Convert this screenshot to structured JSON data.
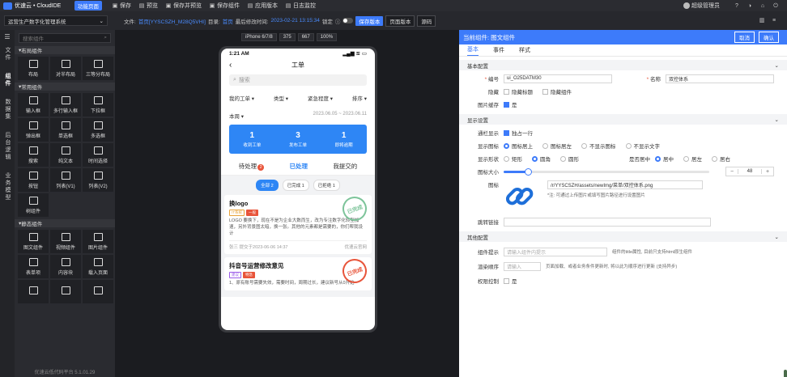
{
  "topbar": {
    "brand": "优速云 • CloudIDE",
    "page_badge": "功能页面",
    "actions": [
      "保存",
      "预览",
      "保存并预览",
      "保存组件",
      "应用版本",
      "日志监控"
    ],
    "user": "超级管理员"
  },
  "secbar": {
    "system": "运营生产数字化管理系统",
    "file_label": "文件:",
    "file_link": "首页[YYSCSZH_M28Q5VHI]",
    "dir_label": "目录:",
    "dir_link": "首页",
    "modified_label": "最后修改时间:",
    "modified_time": "2023-02-21 13:15:34",
    "lock_label": "锁定",
    "btn_save_version": "保存版本",
    "btn_page_version": "页面版本",
    "btn_source": "源码"
  },
  "vtabs": [
    "文件",
    "组件",
    "数据集",
    "后台逻辑",
    "业务模型"
  ],
  "companel": {
    "search_placeholder": "搜索组件",
    "groups": [
      {
        "title": "布局组件",
        "items": [
          "布局",
          "对半布局",
          "三等分布局"
        ]
      },
      {
        "title": "常用组件",
        "items": [
          "输入框",
          "多行输入框",
          "下拉框",
          "弹出框",
          "单选框",
          "多选框",
          "搜索",
          "纯文本",
          "时间选择",
          "按钮",
          "列表(V1)",
          "列表(V2)",
          "树组件"
        ]
      },
      {
        "title": "静态组件",
        "items": [
          "图文组件",
          "视频组件",
          "图片组件",
          "表单项",
          "内容块",
          "载入页面",
          "",
          "",
          ""
        ]
      }
    ],
    "version": "优速云低代码平台 5.1.01.29"
  },
  "devbar": {
    "device": "iPhone 6/7/8",
    "width": "375",
    "height": "667",
    "zoom": "100%"
  },
  "phone": {
    "time": "1:21 AM",
    "signal": "▂▄▆ ≋ ▭",
    "title": "工单",
    "search_placeholder": "搜索",
    "filters": [
      "我的工单 ▾",
      "类型 ▾",
      "紧急程度 ▾",
      "排序 ▾"
    ],
    "period_label": "本周 ▾",
    "period_range": "2023.06.05 ~ 2023.06.11",
    "stats": [
      {
        "n": "1",
        "l": "收到工单"
      },
      {
        "n": "3",
        "l": "发布工单"
      },
      {
        "n": "1",
        "l": "即将逾期"
      }
    ],
    "tabs": [
      "待处理",
      "已处理",
      "我提交的"
    ],
    "tab_count": "2",
    "chips": [
      "全部 2",
      "已完成 1",
      "已拒绝 1"
    ],
    "cards": [
      {
        "title": "换logo",
        "tags": [
          "IT系统",
          "一般"
        ],
        "body": "LOGO 要换下，现在不是为企业大数而生，改为专注数字化转型加速，另外背景图太暗，换一张。其他的元素都是需要的，你们帮我设计",
        "author": "张三 提交于2023-06-06 14:37",
        "org": "优速云官网",
        "stamp": "已完成"
      },
      {
        "title": "抖音号运营修改意见",
        "tags": [
          "建议",
          "特急"
        ],
        "body": "1、原有账号需要失效，需要时间，周期过长，建议新号从0开始",
        "author": "",
        "org": "",
        "stamp": "已完成"
      }
    ]
  },
  "props": {
    "header": "当前组件: 图文组件",
    "cancel": "取消",
    "confirm": "确认",
    "tabs": [
      "基本",
      "事件",
      "样式"
    ],
    "basic": {
      "title": "基本配置",
      "code_label": "编号",
      "code_value": "ui_O25DATM30",
      "name_label": "名称",
      "name_value": "双控体系",
      "hide_label": "隐藏",
      "hide_title": "隐藏标题",
      "hide_comp": "隐藏组件",
      "cache_label": "图片缓存",
      "cache_value": "是"
    },
    "display": {
      "title": "显示设置",
      "single_label": "通栏显示",
      "single_value": "独占一行",
      "icon_label": "显示图标",
      "icon_opts": [
        "图标居上",
        "图标居左",
        "不显示图标",
        "不显示文字"
      ],
      "shape_label": "显示形状",
      "shape_opts": [
        "矩形",
        "圆角",
        "圆形"
      ],
      "center_label": "是否居中",
      "center_opts": [
        "居中",
        "居左",
        "居右"
      ],
      "size_label": "图标大小",
      "size_value": "48",
      "size_fraction": 0.12,
      "img_label": "图标",
      "img_path": "/r/YYSCSZH/assets/newImg/菜单/双控体系.png",
      "img_hint": "*注: 可通过上传图片或填写图片路径进行设置图片",
      "link_label": "跳转链接"
    },
    "other": {
      "title": "其他配置",
      "tip_label": "组件提示",
      "tip_placeholder": "请输入组件内提示",
      "tip_desc": "组件的title属性, 目前只支持html原生组件",
      "order_label": "渲染顺序",
      "order_placeholder": "请输入",
      "order_desc": "页面加载、或者业务条件更新时, 将以此为顺序进行更新 (支持异步)",
      "auth_label": "权限控制",
      "auth_value": "是"
    }
  },
  "colors": {
    "accent": "#3d7bfa",
    "stats_bg": "#2e86f5",
    "stamp": "#7dc49a",
    "danger": "#e8543a"
  }
}
